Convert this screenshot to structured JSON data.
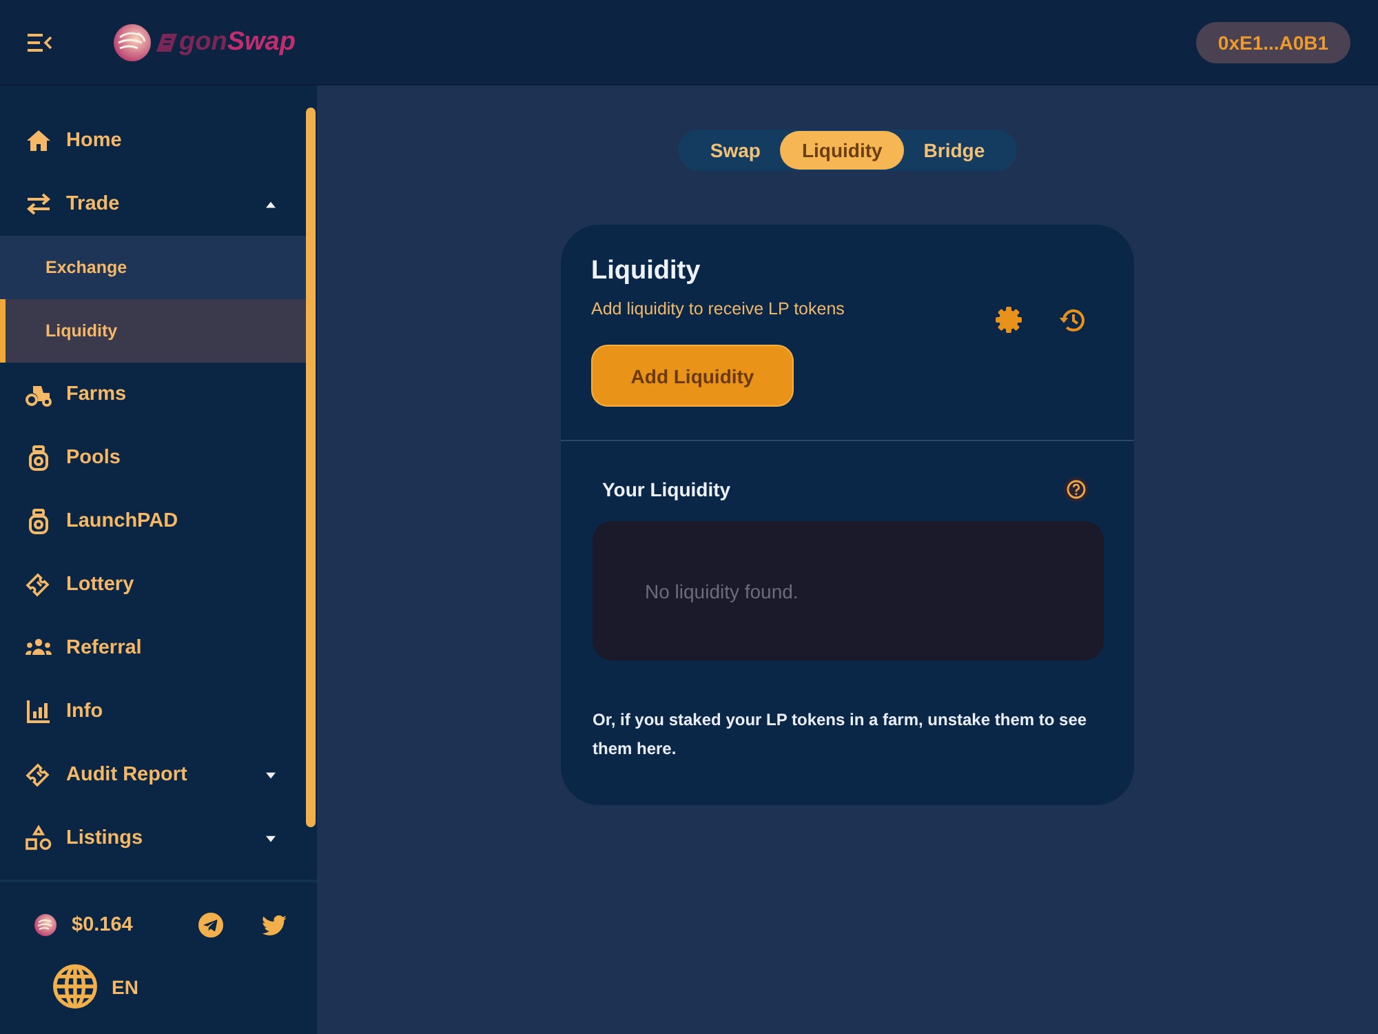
{
  "topbar": {
    "logo": {
      "text_start": "gon",
      "text_end": "Swap"
    },
    "wallet_address": "0xE1...A0B1"
  },
  "sidebar": {
    "items": [
      {
        "label": "Home",
        "kind": "link"
      },
      {
        "label": "Trade",
        "kind": "group",
        "expanded": true,
        "children": [
          {
            "label": "Exchange",
            "selected": false
          },
          {
            "label": "Liquidity",
            "selected": true
          }
        ]
      },
      {
        "label": "Farms",
        "kind": "link"
      },
      {
        "label": "Pools",
        "kind": "link"
      },
      {
        "label": "LaunchPAD",
        "kind": "link"
      },
      {
        "label": "Lottery",
        "kind": "link"
      },
      {
        "label": "Referral",
        "kind": "link"
      },
      {
        "label": "Info",
        "kind": "link"
      },
      {
        "label": "Audit Report",
        "kind": "group",
        "expanded": false
      },
      {
        "label": "Listings",
        "kind": "group",
        "expanded": false
      }
    ],
    "price": "$0.164",
    "language": "EN"
  },
  "tabs": [
    {
      "label": "Swap",
      "selected": false
    },
    {
      "label": "Liquidity",
      "selected": true
    },
    {
      "label": "Bridge",
      "selected": false
    }
  ],
  "card": {
    "title": "Liquidity",
    "subtitle": "Add liquidity to receive LP tokens",
    "add_button": "Add Liquidity",
    "your_liquidity": {
      "heading": "Your Liquidity",
      "empty_message": "No liquidity found.",
      "note": "Or, if you staked your LP tokens in a farm, unstake them to see them here."
    }
  }
}
